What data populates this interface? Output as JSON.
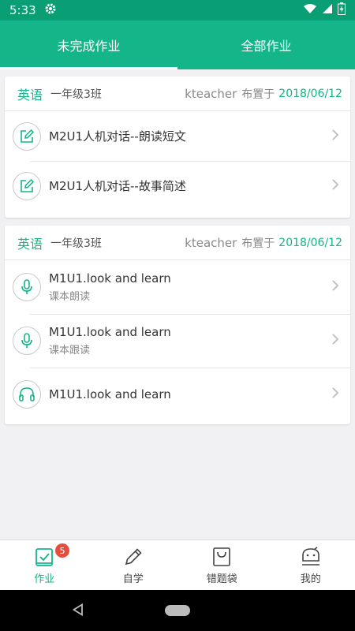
{
  "status": {
    "time": "5:33"
  },
  "tabs": [
    {
      "label": "未完成作业",
      "active": true
    },
    {
      "label": "全部作业",
      "active": false
    }
  ],
  "cards": [
    {
      "subject": "英语",
      "class": "一年级3班",
      "teacher": "kteacher",
      "assigned_label": "布置于",
      "date": "2018/06/12",
      "items": [
        {
          "icon": "edit-icon",
          "title": "M2U1人机对话--朗读短文",
          "subtitle": ""
        },
        {
          "icon": "edit-icon",
          "title": "M2U1人机对话--故事简述",
          "subtitle": ""
        }
      ]
    },
    {
      "subject": "英语",
      "class": "一年级3班",
      "teacher": "kteacher",
      "assigned_label": "布置于",
      "date": "2018/06/12",
      "items": [
        {
          "icon": "microphone-icon",
          "title": "M1U1.look and learn",
          "subtitle": "课本朗读"
        },
        {
          "icon": "microphone-icon",
          "title": "M1U1.look and learn",
          "subtitle": "课本跟读"
        },
        {
          "icon": "headphones-icon",
          "title": "M1U1.look and learn",
          "subtitle": ""
        }
      ]
    }
  ],
  "bottom_nav": [
    {
      "label": "作业",
      "icon": "homework-icon",
      "active": true,
      "badge": "5"
    },
    {
      "label": "自学",
      "icon": "pencil-icon",
      "active": false
    },
    {
      "label": "错题袋",
      "icon": "bag-icon",
      "active": false
    },
    {
      "label": "我的",
      "icon": "profile-icon",
      "active": false
    }
  ],
  "colors": {
    "primary": "#13b589",
    "status_bar": "#0a9e74",
    "badge": "#e84c3d"
  }
}
